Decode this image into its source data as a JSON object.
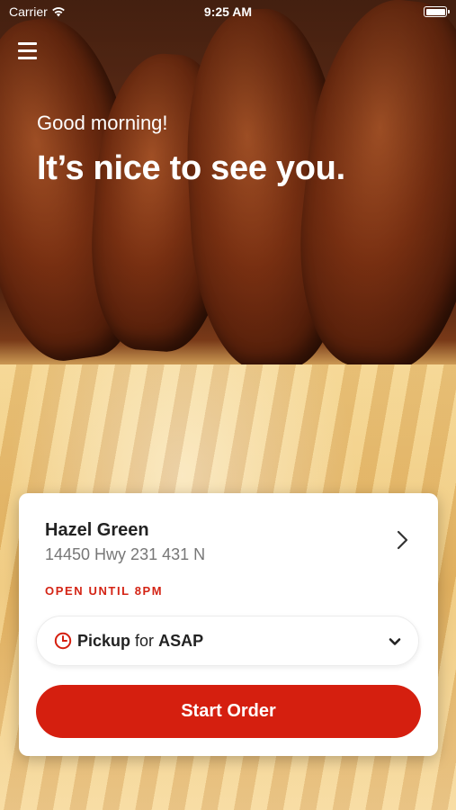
{
  "status_bar": {
    "carrier": "Carrier",
    "time": "9:25 AM"
  },
  "header": {
    "greeting": "Good morning!",
    "headline": "It’s nice to see you."
  },
  "location": {
    "name": "Hazel Green",
    "address": "14450 Hwy 231 431 N",
    "hours": "OPEN UNTIL 8PM"
  },
  "order_mode": {
    "method": "Pickup",
    "connector": "for",
    "time": "ASAP"
  },
  "actions": {
    "start_order_label": "Start Order"
  },
  "colors": {
    "accent": "#d51f0f",
    "hours_text": "#d42415"
  },
  "icons": {
    "menu": "hamburger-menu-icon",
    "store_chevron": "chevron-right-icon",
    "clock": "clock-icon",
    "dropdown": "chevron-down-icon",
    "wifi": "wifi-icon",
    "battery": "battery-icon"
  }
}
